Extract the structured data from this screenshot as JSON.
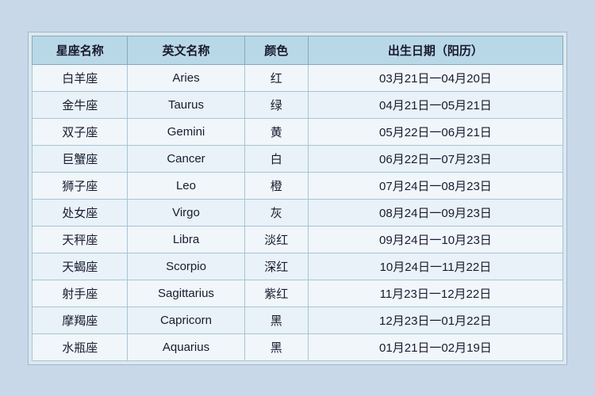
{
  "table": {
    "headers": {
      "zh_name": "星座名称",
      "en_name": "英文名称",
      "color": "颜色",
      "date": "出生日期（阳历）"
    },
    "rows": [
      {
        "zh": "白羊座",
        "en": "Aries",
        "color": "红",
        "date": "03月21日一04月20日"
      },
      {
        "zh": "金牛座",
        "en": "Taurus",
        "color": "绿",
        "date": "04月21日一05月21日"
      },
      {
        "zh": "双子座",
        "en": "Gemini",
        "color": "黄",
        "date": "05月22日一06月21日"
      },
      {
        "zh": "巨蟹座",
        "en": "Cancer",
        "color": "白",
        "date": "06月22日一07月23日"
      },
      {
        "zh": "狮子座",
        "en": "Leo",
        "color": "橙",
        "date": "07月24日一08月23日"
      },
      {
        "zh": "处女座",
        "en": "Virgo",
        "color": "灰",
        "date": "08月24日一09月23日"
      },
      {
        "zh": "天秤座",
        "en": "Libra",
        "color": "淡红",
        "date": "09月24日一10月23日"
      },
      {
        "zh": "天蝎座",
        "en": "Scorpio",
        "color": "深红",
        "date": "10月24日一11月22日"
      },
      {
        "zh": "射手座",
        "en": "Sagittarius",
        "color": "紫红",
        "date": "11月23日一12月22日"
      },
      {
        "zh": "摩羯座",
        "en": "Capricorn",
        "color": "黑",
        "date": "12月23日一01月22日"
      },
      {
        "zh": "水瓶座",
        "en": "Aquarius",
        "color": "黑",
        "date": "01月21日一02月19日"
      }
    ]
  }
}
